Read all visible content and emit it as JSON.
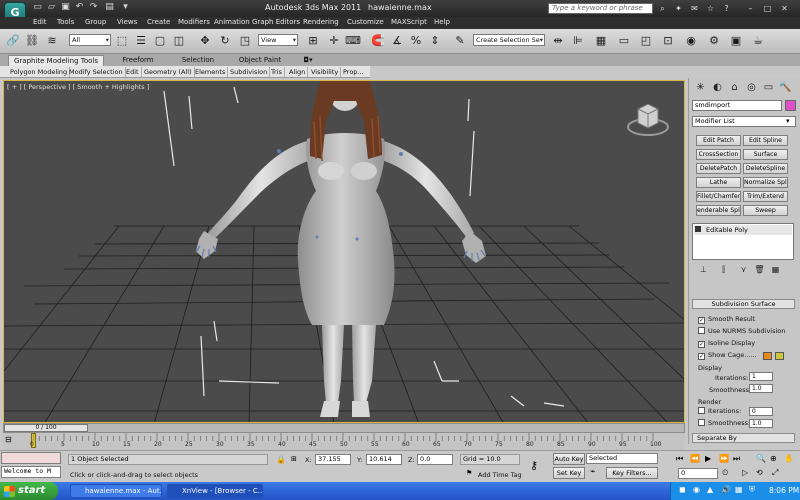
{
  "window": {
    "app_title": "Autodesk 3ds Max  2011",
    "file_title": "hawaienne.max",
    "search_placeholder": "Type a keyword or phrase"
  },
  "menu": [
    "Edit",
    "Tools",
    "Group",
    "Views",
    "Create",
    "Modifiers",
    "Animation",
    "Graph Editors",
    "Rendering",
    "Customize",
    "MAXScript",
    "Help"
  ],
  "toolbar": {
    "selection_filter": "All",
    "ref_coord": "View",
    "named_selection": "Create Selection Se",
    "zoom_badge": "3"
  },
  "ribbon": {
    "tabs": [
      "Graphite Modeling Tools",
      "Freeform",
      "Selection",
      "Object Paint"
    ],
    "active_tab": "Graphite Modeling Tools",
    "subtabs": [
      "Polygon Modeling",
      "Modify Selection",
      "Edit",
      "Geometry (All)",
      "Elements",
      "Subdivision",
      "Tris",
      "Align",
      "Visibility",
      "Prop..."
    ]
  },
  "viewport": {
    "label": "[ + ] [ Perspective ] [ Smooth + Highlights ]"
  },
  "command_panel": {
    "object_name": "smdimport",
    "modifier_list": "Modifier List",
    "modifier_buttons": [
      "Edit Patch",
      "Edit Spline",
      "CrossSection",
      "Surface",
      "DeletePatch",
      "DeleteSpline",
      "Lathe",
      "Normalize Spl.",
      "Fillet/Chamfer",
      "Trim/Extend",
      "enderable Splin",
      "Sweep"
    ],
    "stack_item": "Editable Poly",
    "rollout_title": "Subdivision Surface",
    "smooth_result": "Smooth Result",
    "nurms": "Use NURMS Subdivision",
    "isoline": "Isoline Display",
    "show_cage": "Show Cage......",
    "display_group": "Display",
    "iterations_label": "Iterations:",
    "iterations_value": "1",
    "smoothness_label": "Smoothness:",
    "smoothness_value": "1.0",
    "render_group": "Render",
    "r_iterations_label": "Iterations:",
    "r_iterations_value": "0",
    "r_smoothness_label": "Smoothness:",
    "r_smoothness_value": "1.0",
    "separate_by": "Separate By",
    "cage_color_1": "#e88a1a",
    "cage_color_2": "#c8c83a"
  },
  "timeline": {
    "frame_display": "0 / 100",
    "ticks": [
      "0",
      "5",
      "10",
      "15",
      "20",
      "25",
      "30",
      "35",
      "40",
      "45",
      "50",
      "55",
      "60",
      "65",
      "70",
      "75",
      "80",
      "85",
      "90",
      "95",
      "100"
    ]
  },
  "status": {
    "maxscript_text": "Welcome to M",
    "selection_info": "1 Object Selected",
    "prompt": "Click or click-and-drag to select objects",
    "x_label": "X:",
    "x_value": "37.155",
    "y_label": "Y:",
    "y_value": "10.614",
    "z_label": "Z:",
    "z_value": "0.0",
    "grid": "Grid = 10.0",
    "add_time_tag": "Add Time Tag",
    "auto_key": "Auto Key",
    "set_key": "Set Key",
    "key_filter": "Selected",
    "key_filters_btn": "Key Filters...",
    "frame_field": "0"
  },
  "taskbar": {
    "start": "start",
    "tasks": [
      "hawaienne.max - Aut...",
      "XnView - [Browser - C..."
    ],
    "clock": "8:06 PM"
  }
}
